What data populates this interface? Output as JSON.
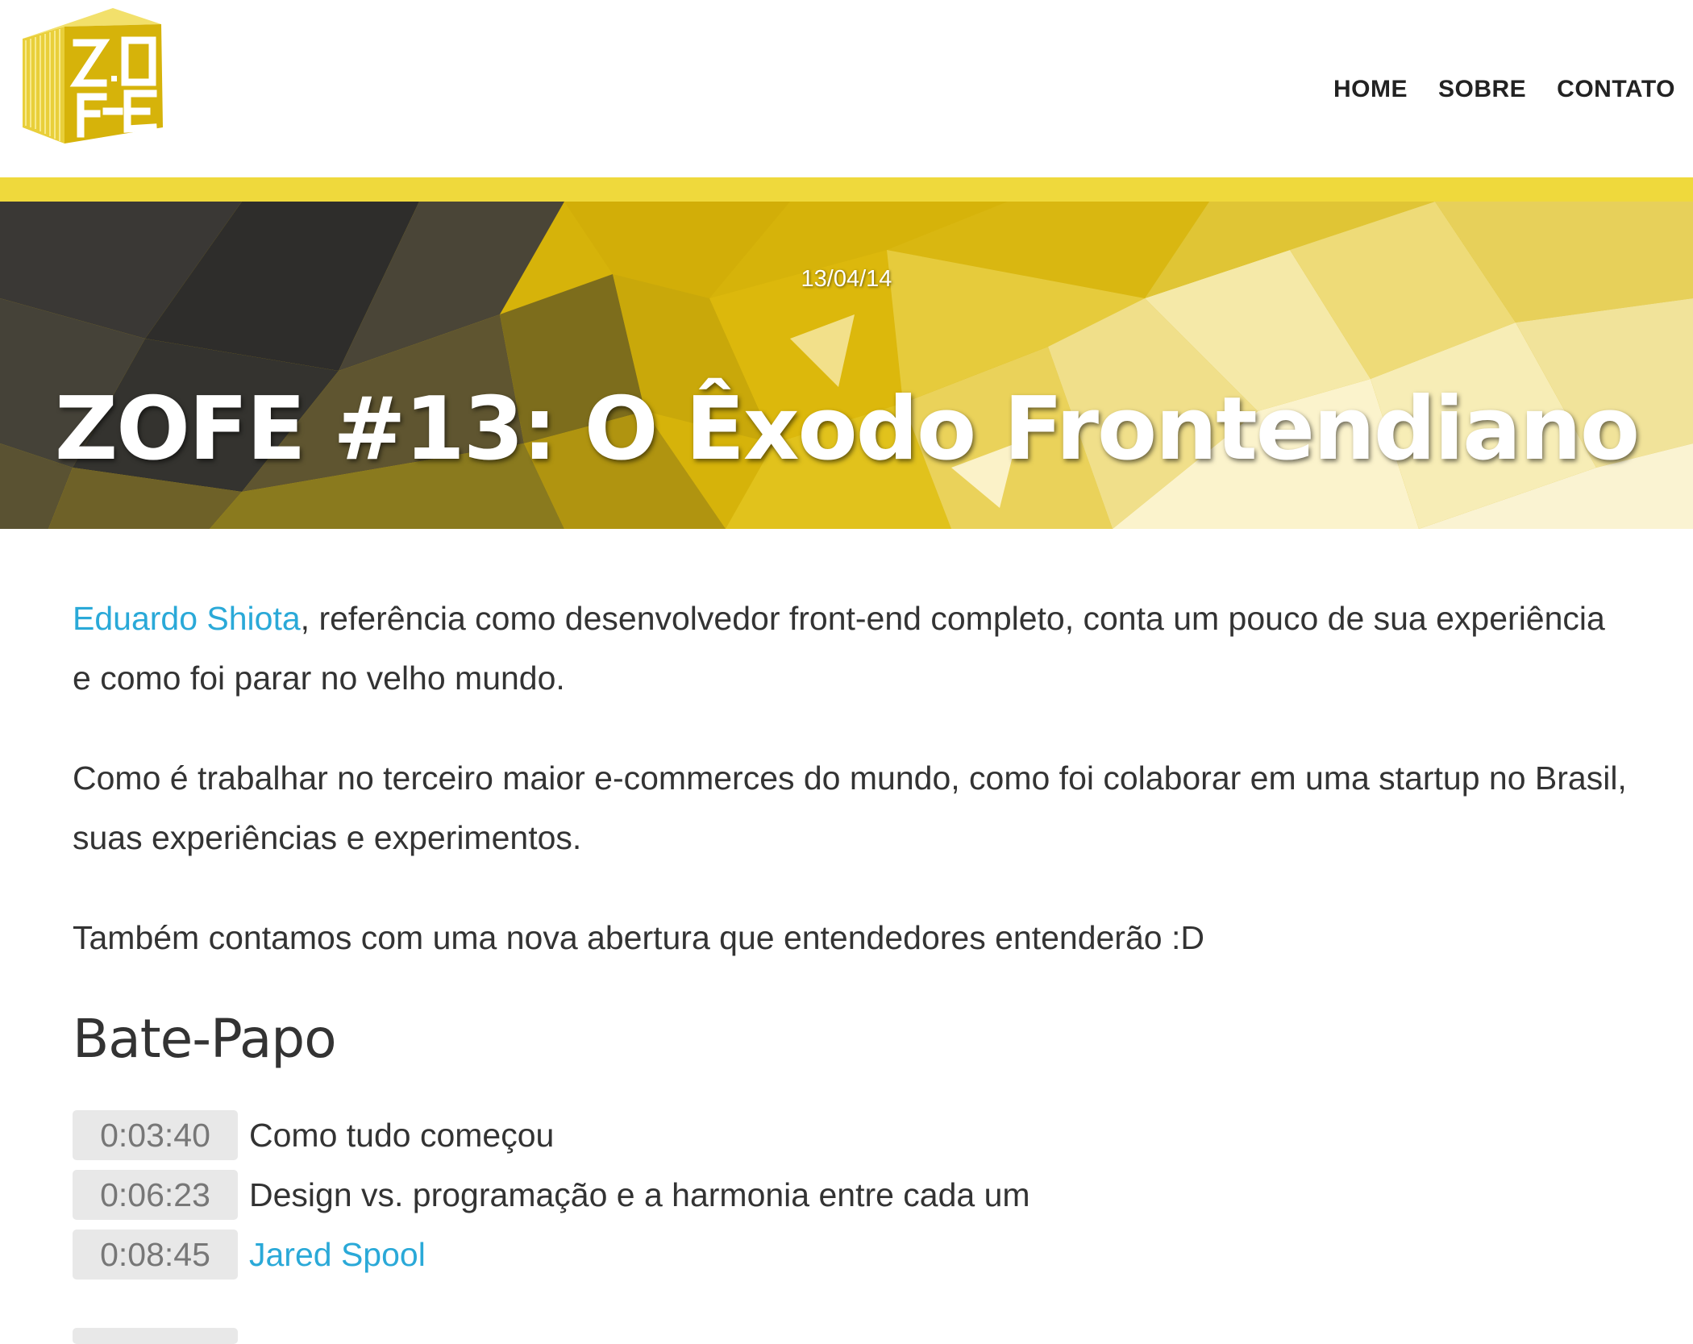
{
  "brand": {
    "logo_text_top": "Z.O",
    "logo_text_bottom": "F-E",
    "colors": {
      "yellow": "#d6b30a",
      "yellow_light": "#efd93c",
      "dark": "#333333",
      "link": "#2aa9d8"
    }
  },
  "nav": {
    "items": [
      {
        "label": "HOME"
      },
      {
        "label": "SOBRE"
      },
      {
        "label": "CONTATO"
      }
    ]
  },
  "hero": {
    "date": "13/04/14",
    "title": "ZOFE #13: O Êxodo Frontendiano"
  },
  "article": {
    "intro": {
      "link_text": "Eduardo Shiota",
      "rest": ", referência como desenvolvedor front-end completo, conta um pouco de sua experiência e como foi parar no velho mundo."
    },
    "paragraph_2": "Como é trabalhar no terceiro maior e-commerces do mundo, como foi colaborar em uma startup no Brasil, suas experiências e experimentos.",
    "paragraph_3": "Também contamos com uma nova abertura que entendedores entenderão :D",
    "section_title": "Bate-Papo",
    "chapters": [
      {
        "time": "0:03:40",
        "text": "Como tudo começou",
        "is_link": false
      },
      {
        "time": "0:06:23",
        "text": "Design vs. programação e a harmonia entre cada um",
        "is_link": false
      },
      {
        "time": "0:08:45",
        "text": "Jared Spool",
        "is_link": true
      }
    ]
  }
}
